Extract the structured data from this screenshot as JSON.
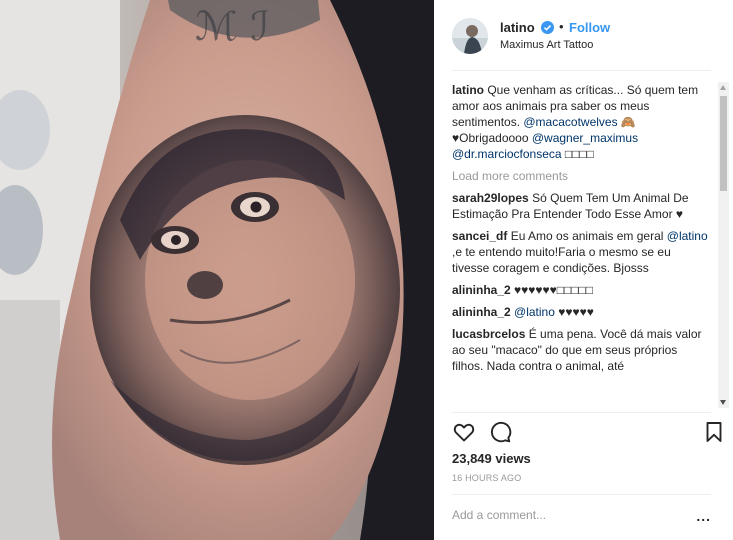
{
  "post": {
    "username": "latino",
    "follow_label": "Follow",
    "separator": "•",
    "location": "Maximus Art Tattoo"
  },
  "caption": {
    "username": "latino",
    "text": "Que venham as críticas... Só quem tem amor aos animais pra saber os meus sentimentos. ",
    "mention1": "@macacotwelves",
    "emoji1": " 🙈",
    "text2": "♥Obrigadoooo ",
    "mention2": "@wagner_maximus",
    "mention3": "@dr.marciocfonseca",
    "trailing": " □□□□"
  },
  "load_more": "Load more comments",
  "comments": [
    {
      "username": "sarah29lopes",
      "text": "Só Quem Tem Um Animal De Estimação Pra Entender Todo Esse Amor ♥"
    },
    {
      "username": "sancei_df",
      "text": "Eu Amo os animais em geral ",
      "mention": "@latino",
      "text2": " ,e te entendo muito!Faria o mesmo se eu tivesse coragem e condições. Bjosss"
    },
    {
      "username": "alininha_2",
      "text": "♥♥♥♥♥♥□□□□□"
    },
    {
      "username": "alininha_2",
      "mention": "@latino",
      "text": " ♥♥♥♥♥"
    },
    {
      "username": "lucasbrcelos",
      "text": "É uma pena. Você dá mais valor ao seu \"macaco\" do que em seus próprios filhos. Nada contra o animal, até"
    }
  ],
  "stats": {
    "views": "23,849 views",
    "timestamp": "16 HOURS AGO"
  },
  "composer": {
    "placeholder": "Add a comment...",
    "more_label": "..."
  },
  "icons": [
    "heart-icon",
    "comment-icon",
    "bookmark-icon",
    "verified-badge-icon"
  ],
  "colors": {
    "accent": "#3897f0",
    "mention": "#003569",
    "muted": "#999999"
  }
}
